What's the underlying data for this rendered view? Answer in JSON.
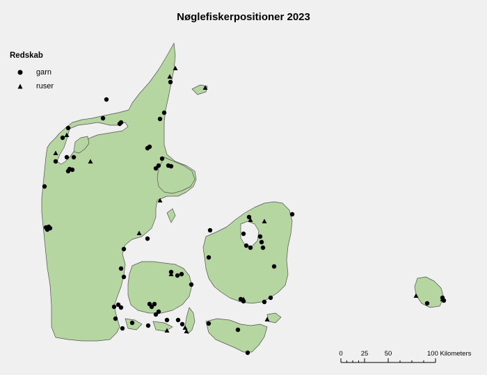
{
  "map": {
    "title": "Nøglefiskerpositioner 2023",
    "land_color": "#b5d6a0",
    "coast_color": "#505050",
    "background_color": "#f0f0f0"
  },
  "legend": {
    "title": "Redskab",
    "items": [
      {
        "label": "garn",
        "symbol": "circle"
      },
      {
        "label": "ruser",
        "symbol": "triangle"
      }
    ]
  },
  "scalebar": {
    "ticks": [
      "0",
      "25",
      "50",
      "100 Kilometers"
    ]
  }
}
